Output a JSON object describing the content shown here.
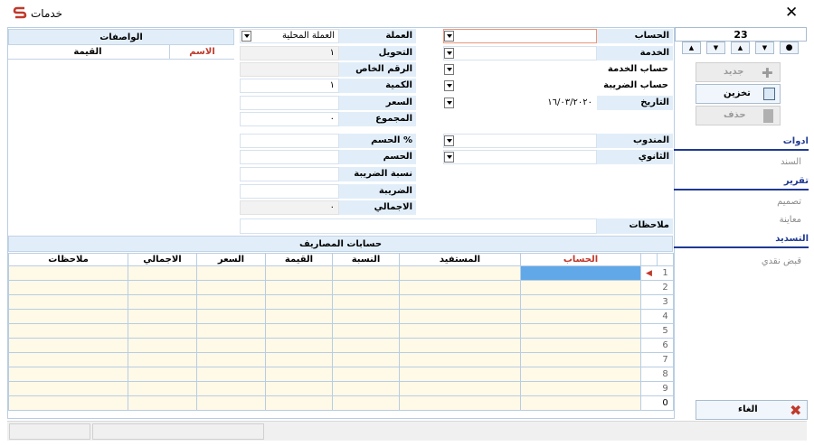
{
  "window": {
    "title": "خدمات",
    "close_glyph": "✕",
    "logo_glyph": "S",
    "brand_color": "#c0392b"
  },
  "navigation": {
    "record_number": "23"
  },
  "toolbar": {
    "new_label": "جديد",
    "save_label": "تخزين",
    "delete_label": "حذف",
    "cancel_label": "الغاء"
  },
  "side_menu": {
    "tools_header": "ادوات",
    "voucher_item": "السند",
    "report_header": "تقرير",
    "design_item": "تصميم",
    "preview_item": "معاينة",
    "payment_header": "التسديد",
    "cash_receipt_item": "قبض نقدي"
  },
  "form": {
    "account_label": "الحساب",
    "service_label": "الخدمة",
    "service_account_label": "حساب الخدمة",
    "tax_account_label": "حساب الضريبة",
    "date_label": "التاريخ",
    "date_value": "١٦/٠٣/٢٠٢٠",
    "delegate_label": "المندوب",
    "secondary_label": "الثانوي",
    "currency_label": "العملة",
    "currency_value": "العملة المحلية",
    "conversion_label": "التحويل",
    "conversion_value": "١",
    "special_number_label": "الرقم الخاص",
    "quantity_label": "الكمية",
    "quantity_value": "١",
    "price_label": "السعر",
    "total_label": "المجموع",
    "total_value": "٠",
    "discount_percent_label": "الحسم %",
    "discount_label": "الحسم",
    "tax_rate_label": "نسبة الضريبة",
    "tax_label": "الضريبة",
    "grand_total_label": "الاجمالي",
    "grand_total_value": "٠",
    "notes_label": "ملاحظات"
  },
  "descriptions": {
    "title": "الواصفات",
    "name_col": "الاسم",
    "value_col": "القيمة"
  },
  "expenses": {
    "title": "حسابات المصاريف",
    "columns": {
      "account": "الحساب",
      "beneficiary": "المستفيد",
      "percent": "النسبة",
      "value": "القيمة",
      "price": "السعر",
      "total": "الاجمالي",
      "notes": "ملاحظات"
    },
    "row_numbers": [
      "1",
      "2",
      "3",
      "4",
      "5",
      "6",
      "7",
      "8",
      "9",
      "0"
    ],
    "current_row_marker": "◀"
  },
  "colors": {
    "label_bg": "#e1eef9",
    "accent_blue": "#1f3a93",
    "selected_cell": "#61a8e8",
    "grid_row": "#fff9e8",
    "cancel_red": "#c0392b"
  }
}
